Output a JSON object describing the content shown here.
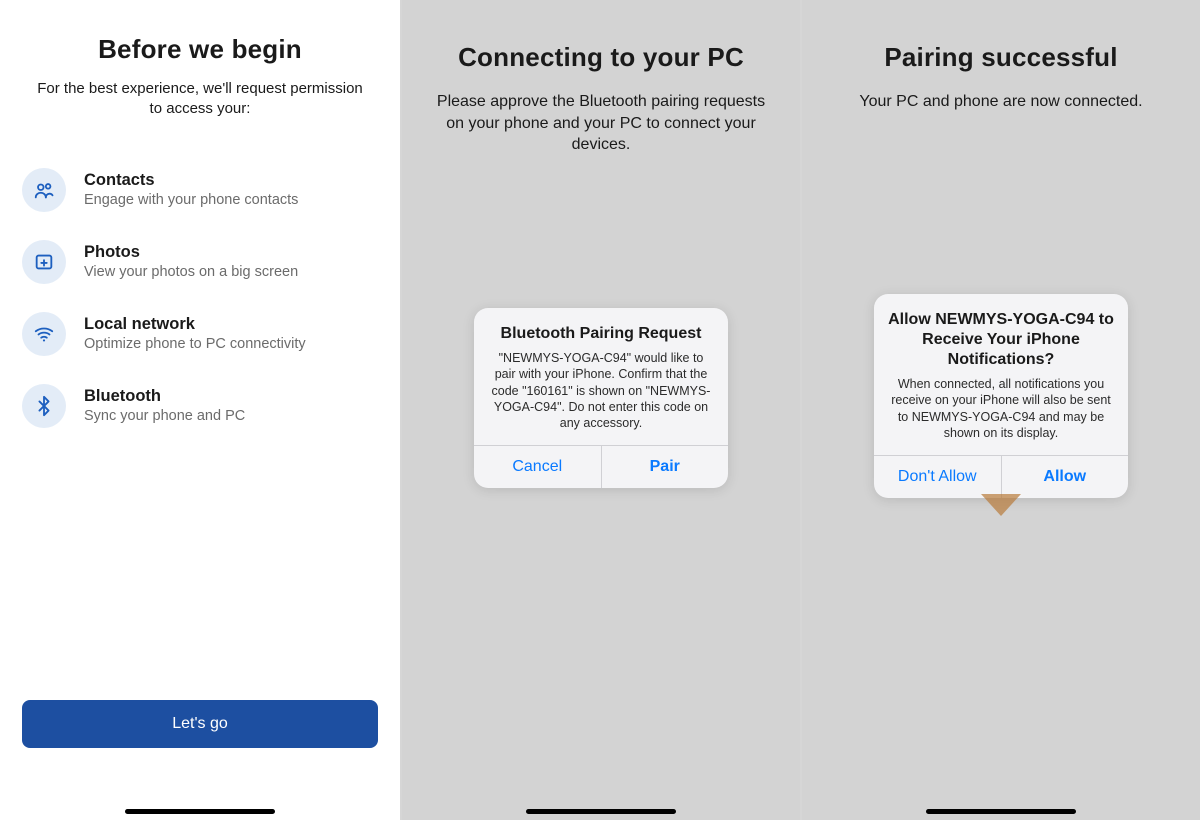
{
  "panel1": {
    "title": "Before we begin",
    "subtitle": "For the best experience, we'll request permission to access your:",
    "items": [
      {
        "title": "Contacts",
        "desc": "Engage with your phone contacts",
        "icon": "contacts-icon"
      },
      {
        "title": "Photos",
        "desc": "View your photos on a big screen",
        "icon": "photos-icon"
      },
      {
        "title": "Local network",
        "desc": "Optimize phone to PC connectivity",
        "icon": "wifi-icon"
      },
      {
        "title": "Bluetooth",
        "desc": "Sync your phone and PC",
        "icon": "bluetooth-icon"
      }
    ],
    "cta": "Let's go"
  },
  "panel2": {
    "title": "Connecting to your PC",
    "subtitle": "Please approve the Bluetooth pairing requests on your phone and your PC to connect your devices.",
    "alert": {
      "title": "Bluetooth Pairing Request",
      "message": "\"NEWMYS-YOGA-C94\" would like to pair with your iPhone. Confirm that the code \"160161\" is shown on \"NEWMYS-YOGA-C94\". Do not enter this code on any accessory.",
      "cancel": "Cancel",
      "confirm": "Pair"
    }
  },
  "panel3": {
    "title": "Pairing successful",
    "subtitle": "Your PC and phone are now connected.",
    "alert": {
      "title": "Allow NEWMYS-YOGA-C94 to Receive Your iPhone Notifications?",
      "message": "When connected, all notifications you receive on your iPhone will also be sent to NEWMYS-YOGA-C94 and may be shown on its display.",
      "cancel": "Don't Allow",
      "confirm": "Allow"
    }
  },
  "colors": {
    "brand_blue": "#1d4fa1",
    "icon_blue": "#1d5fbf",
    "icon_bg": "#e3ecf7",
    "ios_link": "#0a7aff"
  }
}
